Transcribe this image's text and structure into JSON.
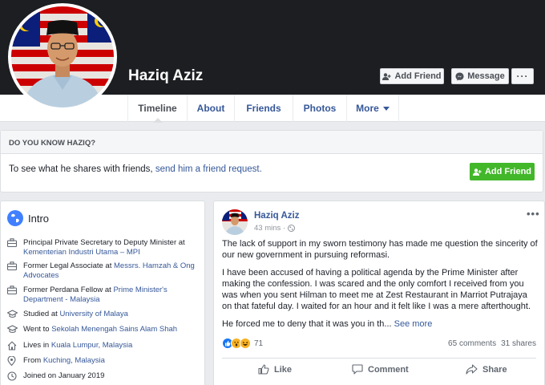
{
  "profile": {
    "name": "Haziq Aziz",
    "buttons": {
      "add_friend": "Add Friend",
      "message": "Message",
      "more": "···"
    }
  },
  "nav": {
    "tabs": [
      {
        "label": "Timeline",
        "active": true
      },
      {
        "label": "About"
      },
      {
        "label": "Friends"
      },
      {
        "label": "Photos"
      },
      {
        "label": "More"
      }
    ]
  },
  "know_box": {
    "title": "DO YOU KNOW HAZIQ?",
    "text": "To see what he shares with friends,",
    "link": "send him a friend request.",
    "button": "Add Friend",
    "button_color": "#42b72a"
  },
  "intro": {
    "title": "Intro",
    "items": [
      {
        "icon": "briefcase-icon",
        "prefix": "Principal Private Secretary to Deputy Minister at",
        "link": "Kementerian Industri Utama – MPI"
      },
      {
        "icon": "briefcase-icon",
        "prefix": "Former Legal Associate at",
        "link": "Messrs. Hamzah & Ong Advocates"
      },
      {
        "icon": "briefcase-icon",
        "prefix": "Former Perdana Fellow at",
        "link": "Prime Minister's Department - Malaysia"
      },
      {
        "icon": "graduation-cap-icon",
        "prefix": "Studied at",
        "link": "University of Malaya"
      },
      {
        "icon": "graduation-cap-icon",
        "prefix": "Went to",
        "link": "Sekolah Menengah Sains Alam Shah"
      },
      {
        "icon": "home-icon",
        "prefix": "Lives in",
        "link": "Kuala Lumpur, Malaysia"
      },
      {
        "icon": "location-pin-icon",
        "prefix": "From",
        "link": "Kuching, Malaysia"
      },
      {
        "icon": "clock-icon",
        "prefix": "Joined on January 2019",
        "link": ""
      }
    ]
  },
  "post": {
    "author": "Haziq Aziz",
    "time": "43 mins ·",
    "privacy_icon": "globe-icon",
    "paragraphs": [
      "The lack of support in my sworn testimony has made me question the sincerity of our new government in pursuing reformasi.",
      "I have been accused of having a political agenda by the Prime Minister after making the confession. I was scared and the only comfort I received from you was when you sent Hilman to meet me at Zest Restaurant in Marriot Putrajaya on that fateful day. I waited for an hour and it felt like I was a mere afterthought."
    ],
    "teaser": "He forced me to deny that it was you in th...",
    "see_more": "See more",
    "reaction_count": "71",
    "comments": "65 comments",
    "shares": "31 shares",
    "actions": {
      "like": "Like",
      "comment": "Comment",
      "share": "Share"
    }
  },
  "colors": {
    "accent": "#365899",
    "cover": "#1c1e21",
    "background": "#e9ebee"
  }
}
